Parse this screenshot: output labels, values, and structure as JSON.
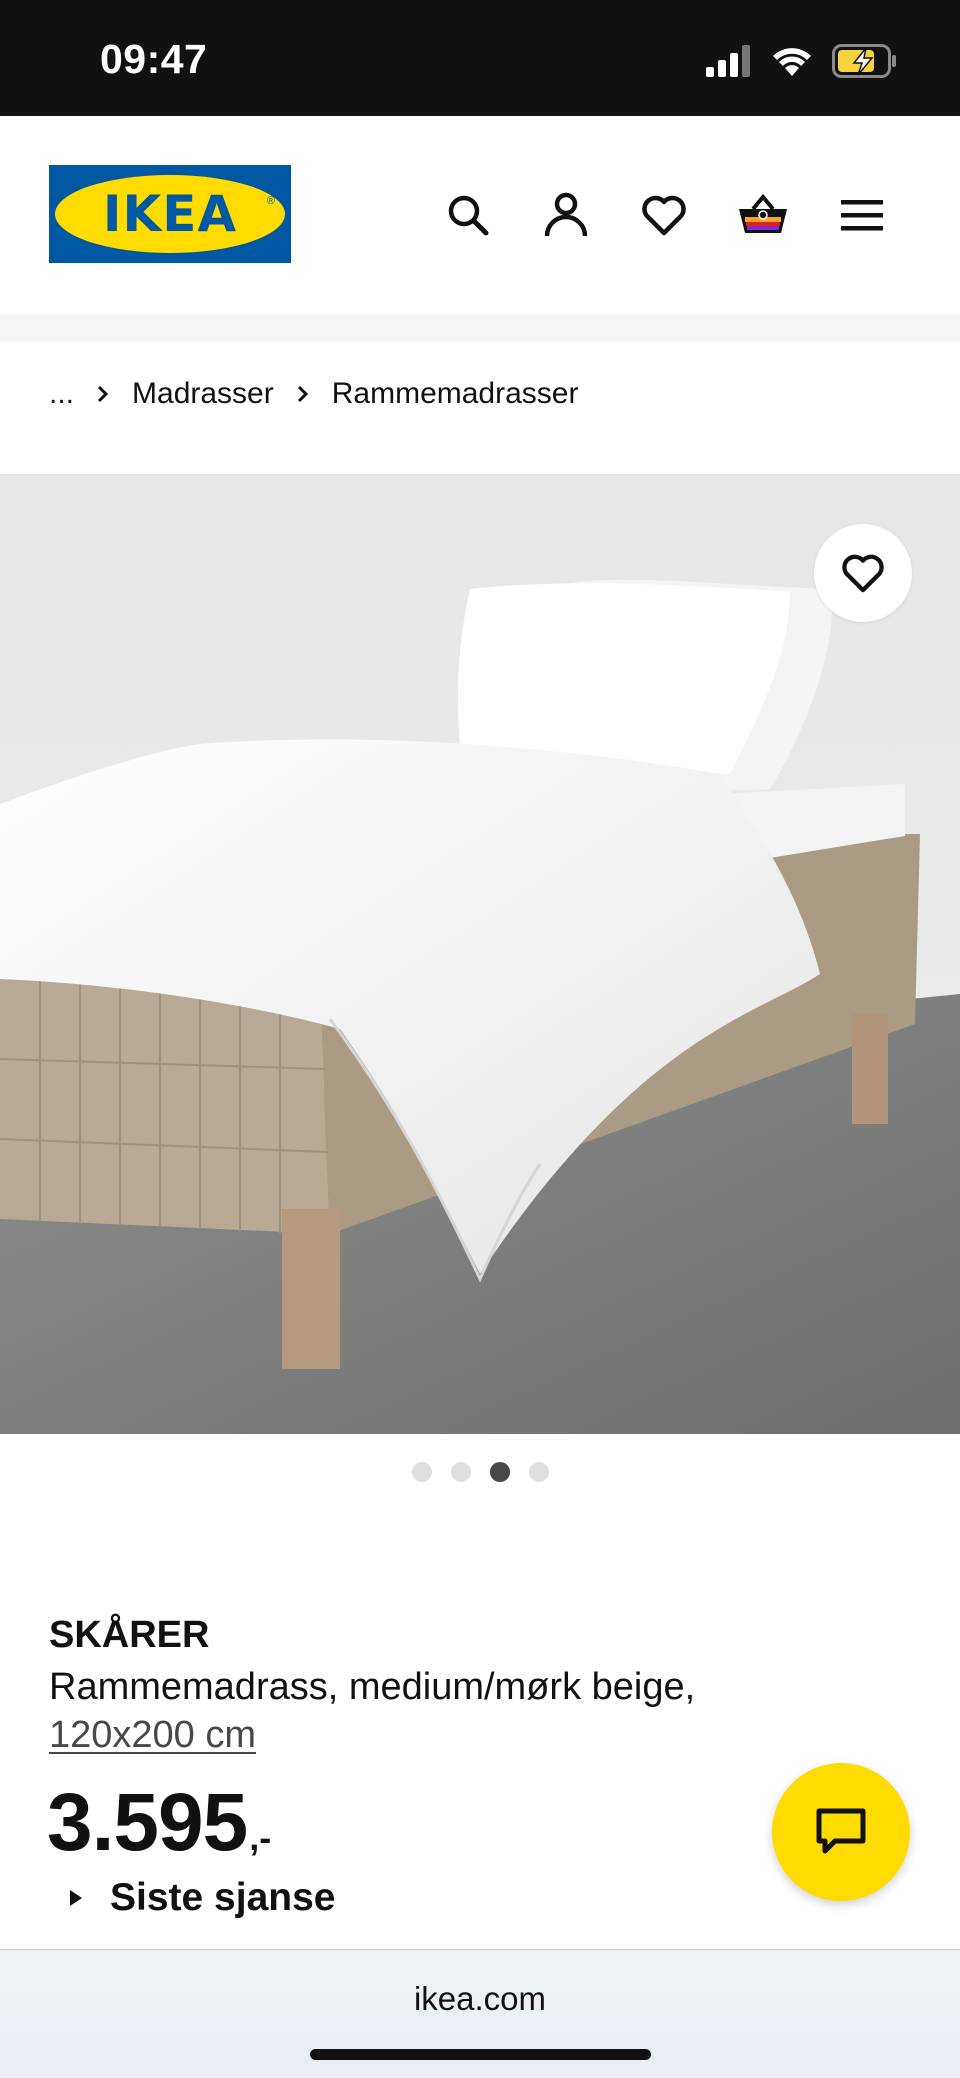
{
  "status_bar": {
    "time": "09:47",
    "icons": [
      "signal-icon",
      "wifi-icon",
      "battery-charging-icon"
    ],
    "battery_color": "#f6d33e"
  },
  "header": {
    "logo_text": "IKEA",
    "logo_reg": "®",
    "brand_colors": {
      "blue": "#0058a3",
      "yellow": "#ffdb00"
    },
    "icons": [
      "search-icon",
      "account-icon",
      "heart-icon",
      "cart-icon",
      "menu-icon"
    ]
  },
  "breadcrumb": {
    "items": [
      "...",
      "Madrasser",
      "Rammemadrasser"
    ]
  },
  "gallery": {
    "image_alt": "bed-photo",
    "dots_count": 4,
    "active_index": 2
  },
  "product": {
    "name": "SKÅRER",
    "description": "Rammemadrass, medium/mørk beige,",
    "size": "120x200 cm",
    "price_main": "3.595",
    "price_suffix": ",-",
    "badge": "Siste sjanse"
  },
  "chat": {
    "icon": "chat-icon",
    "color": "#ffdb00"
  },
  "browser": {
    "url": "ikea.com"
  }
}
